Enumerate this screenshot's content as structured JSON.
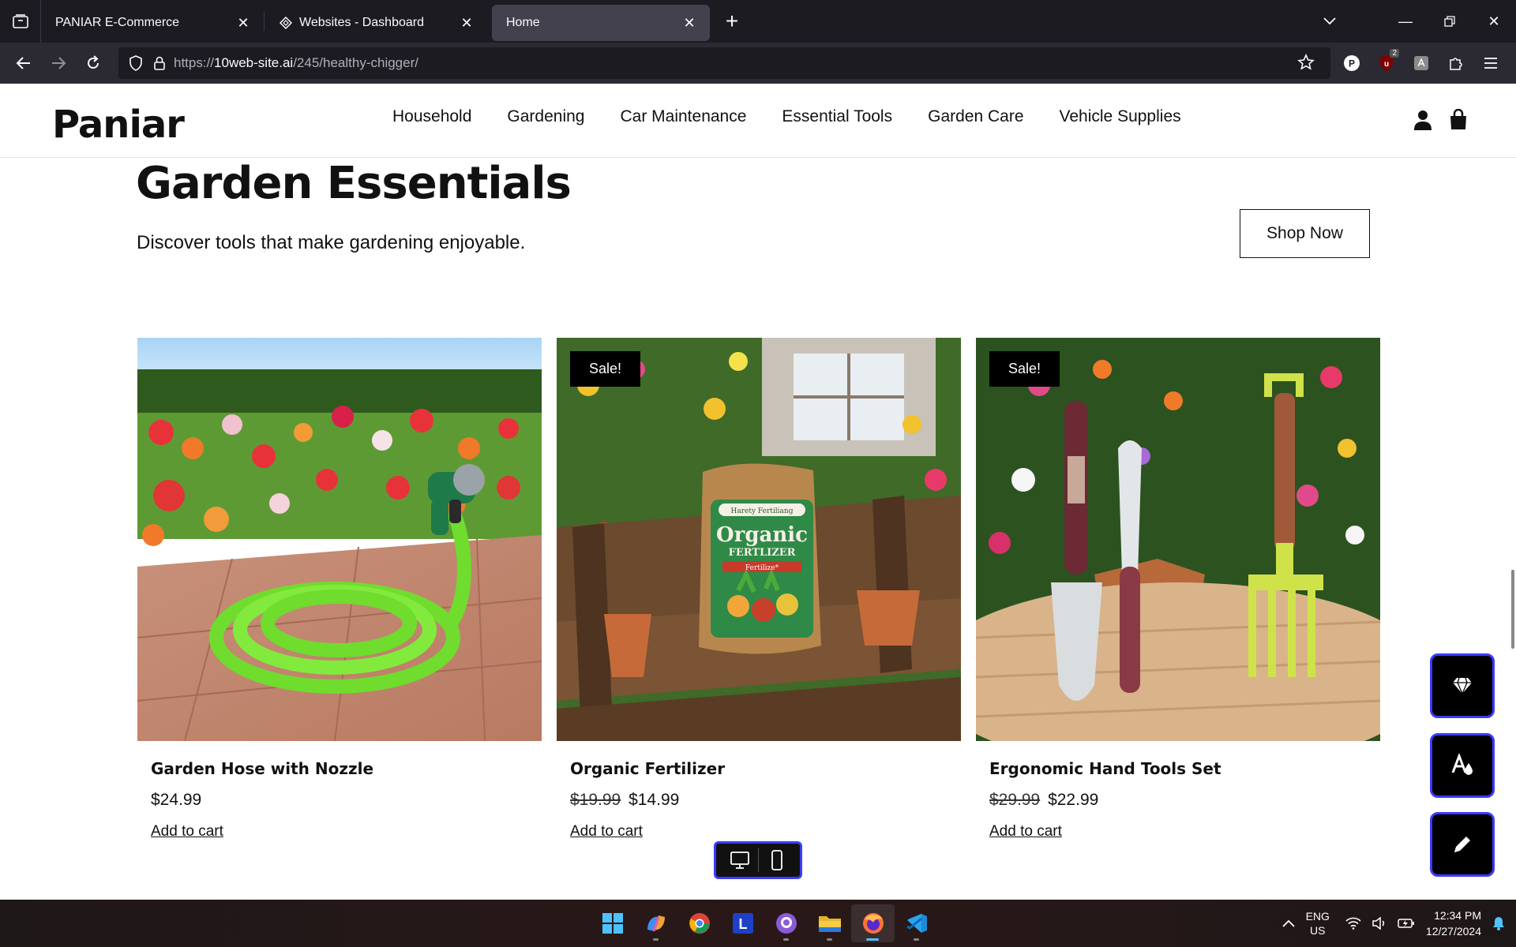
{
  "browser": {
    "tabs": [
      {
        "title": "PANIAR E-Commerce"
      },
      {
        "title": "Websites - Dashboard"
      },
      {
        "title": "Home"
      }
    ],
    "url_prefix": "https://",
    "url_domain": "10web-site.ai",
    "url_path": "/245/healthy-chigger/",
    "extension_badge": "2",
    "accent": "#42414d"
  },
  "site": {
    "logo": "Paniar",
    "nav": [
      "Household",
      "Gardening",
      "Car Maintenance",
      "Essential Tools",
      "Garden Care",
      "Vehicle Supplies"
    ]
  },
  "hero": {
    "title": "Garden Essentials",
    "subtitle": "Discover tools that make gardening enjoyable.",
    "cta": "Shop Now"
  },
  "products": [
    {
      "name": "Garden Hose with Nozzle",
      "old_price": "",
      "price": "$24.99",
      "badge": "",
      "cta": "Add to cart"
    },
    {
      "name": "Organic Fertilizer",
      "old_price": "$19.99",
      "price": "$14.99",
      "badge": "Sale!",
      "cta": "Add to cart"
    },
    {
      "name": "Ergonomic Hand Tools Set",
      "old_price": "$29.99",
      "price": "$22.99",
      "badge": "Sale!",
      "cta": "Add to cart"
    }
  ],
  "product_images": {
    "fertilizer_bag": [
      "Harety Fertiliang",
      "Organic",
      "FERTLIZER",
      "Fertilize*"
    ]
  },
  "taskbar": {
    "lang": [
      "ENG",
      "US"
    ],
    "time": "12:34 PM",
    "date": "12/27/2024"
  },
  "colors": {
    "accent_blue": "#3b3bff",
    "hose_green": "#7ee03a"
  }
}
